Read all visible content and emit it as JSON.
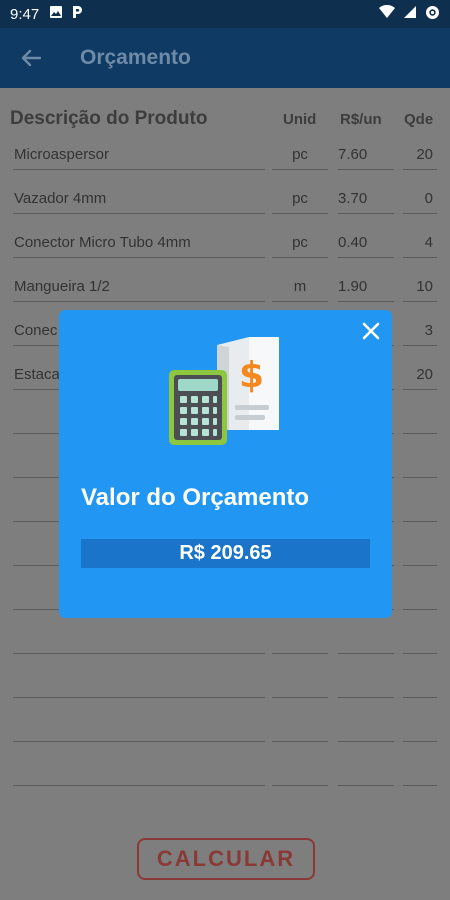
{
  "status_bar": {
    "time": "9:47",
    "icons": [
      "image-icon",
      "parking-icon",
      "wifi-icon",
      "signal-icon",
      "battery-saver-icon"
    ]
  },
  "app_bar": {
    "back_icon": "arrow-back-icon",
    "title": "Orçamento"
  },
  "table": {
    "headers": {
      "description": "Descrição do Produto",
      "unit": "Unid",
      "price": "R$/un",
      "qty": "Qde"
    },
    "rows": [
      {
        "description": "Microaspersor",
        "unit": "pc",
        "price": "7.60",
        "qty": "20"
      },
      {
        "description": "Vazador 4mm",
        "unit": "pc",
        "price": "3.70",
        "qty": "0"
      },
      {
        "description": "Conector Micro Tubo 4mm",
        "unit": "pc",
        "price": "0.40",
        "qty": "4"
      },
      {
        "description": "Mangueira 1/2",
        "unit": "m",
        "price": "1.90",
        "qty": "10"
      },
      {
        "description": "Conec",
        "unit": "",
        "price": "",
        "qty": "3"
      },
      {
        "description": "Estaca",
        "unit": "",
        "price": "",
        "qty": "20"
      },
      {
        "description": "",
        "unit": "",
        "price": "",
        "qty": ""
      },
      {
        "description": "",
        "unit": "",
        "price": "",
        "qty": ""
      },
      {
        "description": "",
        "unit": "",
        "price": "",
        "qty": ""
      },
      {
        "description": "",
        "unit": "",
        "price": "",
        "qty": ""
      },
      {
        "description": "",
        "unit": "",
        "price": "",
        "qty": ""
      },
      {
        "description": "",
        "unit": "",
        "price": "",
        "qty": ""
      },
      {
        "description": "",
        "unit": "",
        "price": "",
        "qty": ""
      },
      {
        "description": "",
        "unit": "",
        "price": "",
        "qty": ""
      },
      {
        "description": "",
        "unit": "",
        "price": "",
        "qty": ""
      }
    ]
  },
  "calculate_button": "CALCULAR",
  "modal": {
    "title": "Valor do Orçamento",
    "value": "R$ 209.65",
    "close_icon": "close-icon",
    "illustration": "calculator-invoice-icon"
  },
  "colors": {
    "status_bar": "#0f2f4e",
    "app_bar": "#0e3a63",
    "overlay": "#7e7e7e",
    "modal": "#2196f3",
    "value_bar": "#1a74c9",
    "button_border": "#8a3a36"
  }
}
